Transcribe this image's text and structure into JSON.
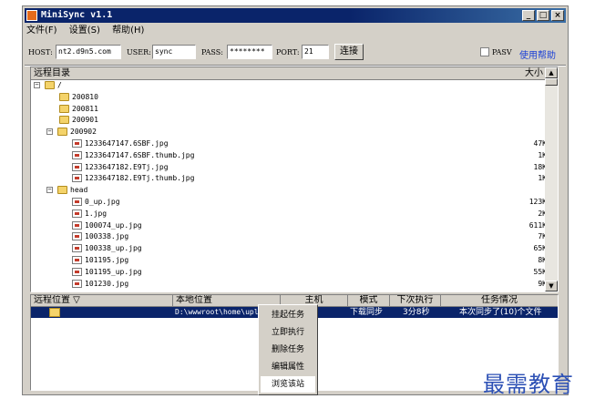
{
  "window": {
    "title": "MiniSync v1.1"
  },
  "menu": [
    "文件(F)",
    "设置(S)",
    "帮助(H)"
  ],
  "connection": {
    "host_label": "HOST:",
    "host_value": "nt2.d9n5.com",
    "user_label": "USER:",
    "user_value": "sync",
    "pass_label": "PASS:",
    "pass_value": "********",
    "port_label": "PORT:",
    "port_value": "21",
    "connect_button": "连接",
    "pasv_label": "PASV",
    "help_link": "使用帮助"
  },
  "remote": {
    "header_dir": "远程目录",
    "header_size": "大小",
    "rows": [
      {
        "type": "folder",
        "name": "/",
        "indent": 0,
        "expand": "−",
        "size": ""
      },
      {
        "type": "folder",
        "name": "200810",
        "indent": 2,
        "expand": "",
        "size": ""
      },
      {
        "type": "folder",
        "name": "200811",
        "indent": 2,
        "expand": "",
        "size": ""
      },
      {
        "type": "folder",
        "name": "200901",
        "indent": 2,
        "expand": "",
        "size": ""
      },
      {
        "type": "folder",
        "name": "200902",
        "indent": 1,
        "expand": "−",
        "size": ""
      },
      {
        "type": "file",
        "name": "1233647147.6SBF.jpg",
        "indent": 3,
        "expand": "",
        "size": "47K"
      },
      {
        "type": "file",
        "name": "1233647147.6SBF.thumb.jpg",
        "indent": 3,
        "expand": "",
        "size": "1K"
      },
      {
        "type": "file",
        "name": "1233647182.E9Tj.jpg",
        "indent": 3,
        "expand": "",
        "size": "18K"
      },
      {
        "type": "file",
        "name": "1233647182.E9Tj.thumb.jpg",
        "indent": 3,
        "expand": "",
        "size": "1K"
      },
      {
        "type": "folder",
        "name": "head",
        "indent": 1,
        "expand": "−",
        "size": ""
      },
      {
        "type": "file",
        "name": "0_up.jpg",
        "indent": 3,
        "expand": "",
        "size": "123K"
      },
      {
        "type": "file",
        "name": "1.jpg",
        "indent": 3,
        "expand": "",
        "size": "2K"
      },
      {
        "type": "file",
        "name": "100074_up.jpg",
        "indent": 3,
        "expand": "",
        "size": "611K"
      },
      {
        "type": "file",
        "name": "100338.jpg",
        "indent": 3,
        "expand": "",
        "size": "7K"
      },
      {
        "type": "file",
        "name": "100338_up.jpg",
        "indent": 3,
        "expand": "",
        "size": "65K"
      },
      {
        "type": "file",
        "name": "101195.jpg",
        "indent": 3,
        "expand": "",
        "size": "8K"
      },
      {
        "type": "file",
        "name": "101195_up.jpg",
        "indent": 3,
        "expand": "",
        "size": "55K"
      },
      {
        "type": "file",
        "name": "101230.jpg",
        "indent": 3,
        "expand": "",
        "size": "9K"
      }
    ]
  },
  "tasks": {
    "headers": [
      "远程位置 ▽",
      "本地位置",
      "主机",
      "模式",
      "下次执行",
      "任务情况"
    ],
    "row": {
      "remote": "",
      "local": "D:\\wwwroot\\home\\upload...",
      "host": "",
      "mode": "下载同步",
      "next": "3分8秒",
      "status": "本次同步了(10)个文件"
    }
  },
  "context_menu": [
    "挂起任务",
    "立即执行",
    "删除任务",
    "编辑属性",
    "浏览该站"
  ],
  "watermark": "最需教育"
}
